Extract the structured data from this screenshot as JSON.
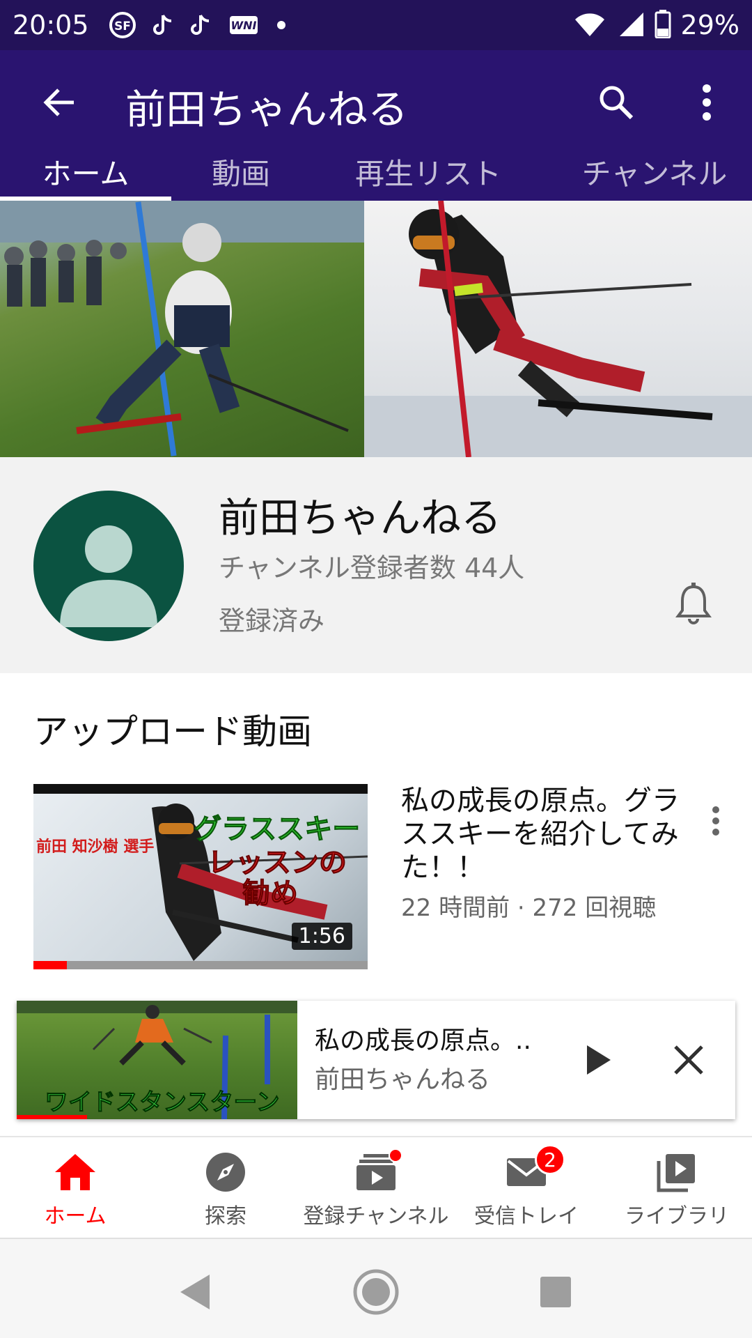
{
  "status_bar": {
    "time": "20:05",
    "battery": "29%",
    "icons": [
      "tsf-icon",
      "tiktok-icon",
      "tiktok-icon",
      "wni-icon",
      "notification-dot",
      "wifi-icon",
      "signal-icon",
      "battery-icon"
    ]
  },
  "app_bar": {
    "title": "前田ちゃんねる",
    "tabs": [
      {
        "label": "ホーム",
        "active": true
      },
      {
        "label": "動画",
        "active": false
      },
      {
        "label": "再生リスト",
        "active": false
      },
      {
        "label": "チャンネル",
        "active": false
      }
    ]
  },
  "channel": {
    "name": "前田ちゃんねる",
    "subscribers": "チャンネル登録者数 44人",
    "status": "登録済み"
  },
  "uploads": {
    "section_title": "アップロード動画",
    "videos": [
      {
        "title": "私の成長の原点。グラススキーを紹介してみた！！",
        "meta": "22 時間前 · 272 回視聴",
        "duration": "1:56",
        "watched_fraction": 0.1,
        "thumb_text_name": "前田 知沙樹 選手",
        "thumb_text_big1": "グラススキー",
        "thumb_text_big2": "レッスンの",
        "thumb_text_big3": "勧め"
      }
    ]
  },
  "mini_player": {
    "title": "私の成長の原点。..",
    "channel": "前田ちゃんねる",
    "thumb_text": "ワイドスタンスターン",
    "progress_fraction": 0.25
  },
  "bottom_nav": {
    "items": [
      {
        "label": "ホーム",
        "icon": "home-icon",
        "active": true
      },
      {
        "label": "探索",
        "icon": "explore-icon",
        "active": false
      },
      {
        "label": "登録チャンネル",
        "icon": "subscriptions-icon",
        "active": false
      },
      {
        "label": "受信トレイ",
        "icon": "inbox-icon",
        "active": false,
        "badge": "2"
      },
      {
        "label": "ライブラリ",
        "icon": "library-icon",
        "active": false
      }
    ]
  },
  "colors": {
    "status_bar": "#231259",
    "app_bar": "#2a1470",
    "accent_red": "#ff0000",
    "avatar_bg": "#0b5341"
  }
}
